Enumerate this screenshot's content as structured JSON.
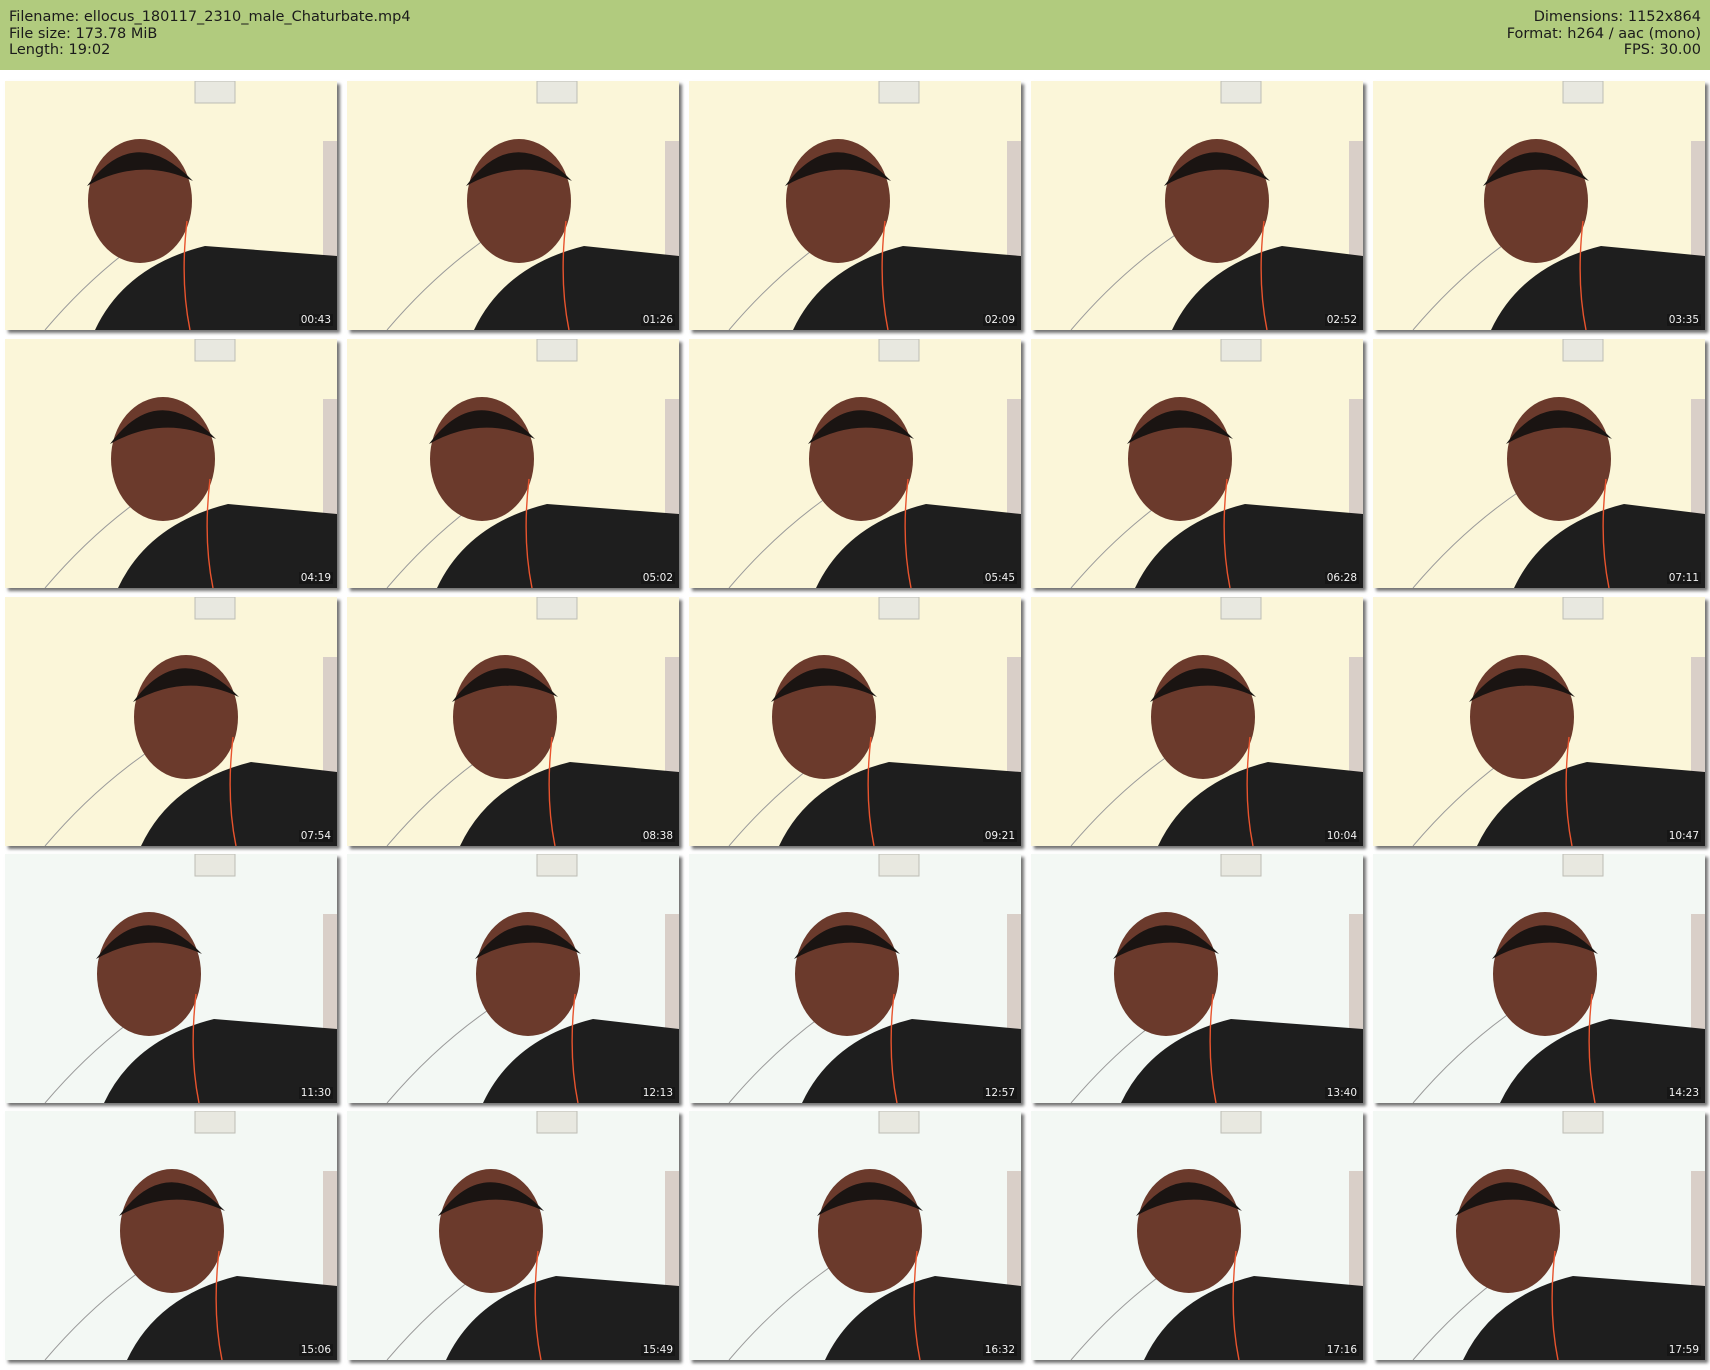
{
  "header": {
    "left": [
      "Filename: ellocus_180117_2310_male_Chaturbate.mp4",
      "File size: 173.78 MiB",
      "Length: 19:02"
    ],
    "right": [
      "Dimensions: 1152x864",
      "Format: h264 / aac (mono)",
      "FPS: 30.00"
    ],
    "background_color": "#b1cb7e"
  },
  "thumbnails": [
    {
      "time": "00:43"
    },
    {
      "time": "01:26"
    },
    {
      "time": "02:09"
    },
    {
      "time": "02:52"
    },
    {
      "time": "03:35"
    },
    {
      "time": "04:19"
    },
    {
      "time": "05:02"
    },
    {
      "time": "05:45"
    },
    {
      "time": "06:28"
    },
    {
      "time": "07:11"
    },
    {
      "time": "07:54"
    },
    {
      "time": "08:38"
    },
    {
      "time": "09:21"
    },
    {
      "time": "10:04"
    },
    {
      "time": "10:47"
    },
    {
      "time": "11:30"
    },
    {
      "time": "12:13"
    },
    {
      "time": "12:57"
    },
    {
      "time": "13:40"
    },
    {
      "time": "14:23"
    },
    {
      "time": "15:06"
    },
    {
      "time": "15:49"
    },
    {
      "time": "16:32"
    },
    {
      "time": "17:16"
    },
    {
      "time": "17:59"
    }
  ]
}
